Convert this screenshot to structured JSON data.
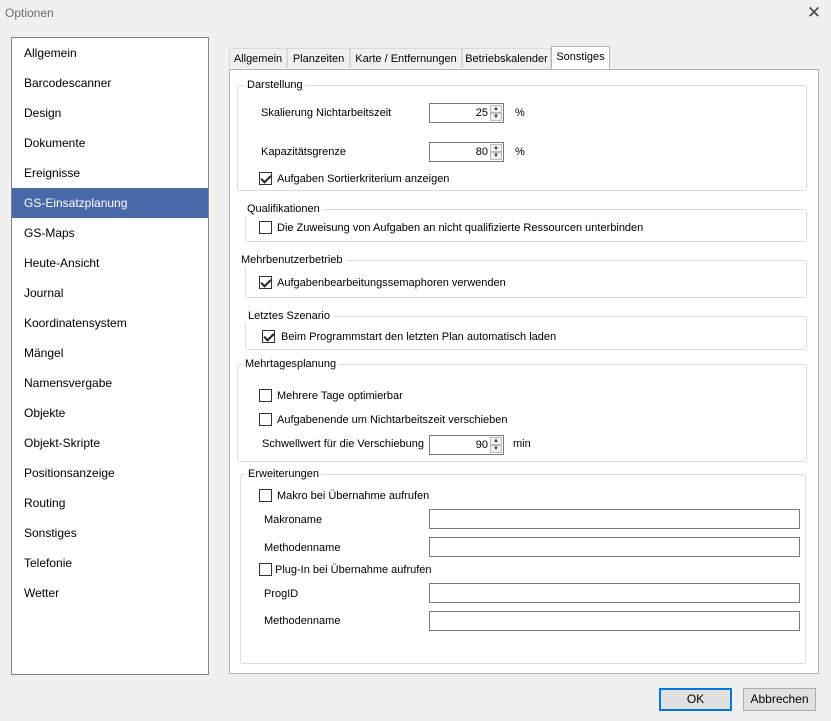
{
  "window": {
    "title": "Optionen",
    "close_glyph": "✕"
  },
  "nav": {
    "items": [
      "Allgemein",
      "Barcodescanner",
      "Design",
      "Dokumente",
      "Ereignisse",
      "GS-Einsatzplanung",
      "GS-Maps",
      "Heute-Ansicht",
      "Journal",
      "Koordinatensystem",
      "Mängel",
      "Namensvergabe",
      "Objekte",
      "Objekt-Skripte",
      "Positionsanzeige",
      "Routing",
      "Sonstiges",
      "Telefonie",
      "Wetter"
    ],
    "selected": "GS-Einsatzplanung",
    "selected_color": "#4968a8"
  },
  "tabs": {
    "items": [
      "Allgemein",
      "Planzeiten",
      "Karte / Entfernungen",
      "Betriebskalender",
      "Sonstiges"
    ],
    "selected": "Sonstiges"
  },
  "darstellung": {
    "title": "Darstellung",
    "skalierung_label": "Skalierung Nichtarbeitszeit",
    "skalierung_value": "25",
    "skalierung_unit": "%",
    "kapazitaet_label": "Kapazitätsgrenze",
    "kapazitaet_value": "80",
    "kapazitaet_unit": "%",
    "sortier_label": "Aufgaben Sortierkriterium anzeigen",
    "sortier_checked": true
  },
  "qualifikationen": {
    "title": "Qualifikationen",
    "zuweisung_label": "Die Zuweisung von Aufgaben an nicht qualifizierte Ressourcen unterbinden",
    "zuweisung_checked": false
  },
  "mehrbenutzer": {
    "title": "Mehrbenutzerbetrieb",
    "semaphoren_label": "Aufgabenbearbeitungssemaphoren verwenden",
    "semaphoren_checked": true
  },
  "szenario": {
    "title": "Letztes Szenario",
    "programmstart_label": "Beim Programmstart den letzten Plan automatisch laden",
    "programmstart_checked": true
  },
  "mehrtages": {
    "title": "Mehrtagesplanung",
    "mehrere_label": "Mehrere Tage optimierbar",
    "mehrere_checked": false,
    "aufgabenende_label": "Aufgabenende um Nichtarbeitszeit verschieben",
    "aufgabenende_checked": false,
    "schwellwert_label": "Schwellwert für die Verschiebung",
    "schwellwert_value": "90",
    "schwellwert_unit": "min"
  },
  "erweiterungen": {
    "title": "Erweiterungen",
    "makro_label": "Makro bei Übernahme aufrufen",
    "makro_checked": false,
    "makroname_label": "Makroname",
    "makroname_value": "",
    "methodenname1_label": "Methodenname",
    "methodenname1_value": "",
    "plugin_label": "Plug-In bei Übernahme aufrufen",
    "plugin_checked": false,
    "progid_label": "ProgID",
    "progid_value": "",
    "methodenname2_label": "Methodenname",
    "methodenname2_value": ""
  },
  "buttons": {
    "ok": "OK",
    "cancel": "Abbrechen"
  },
  "spinner": {
    "up": "▲",
    "down": "▼"
  }
}
